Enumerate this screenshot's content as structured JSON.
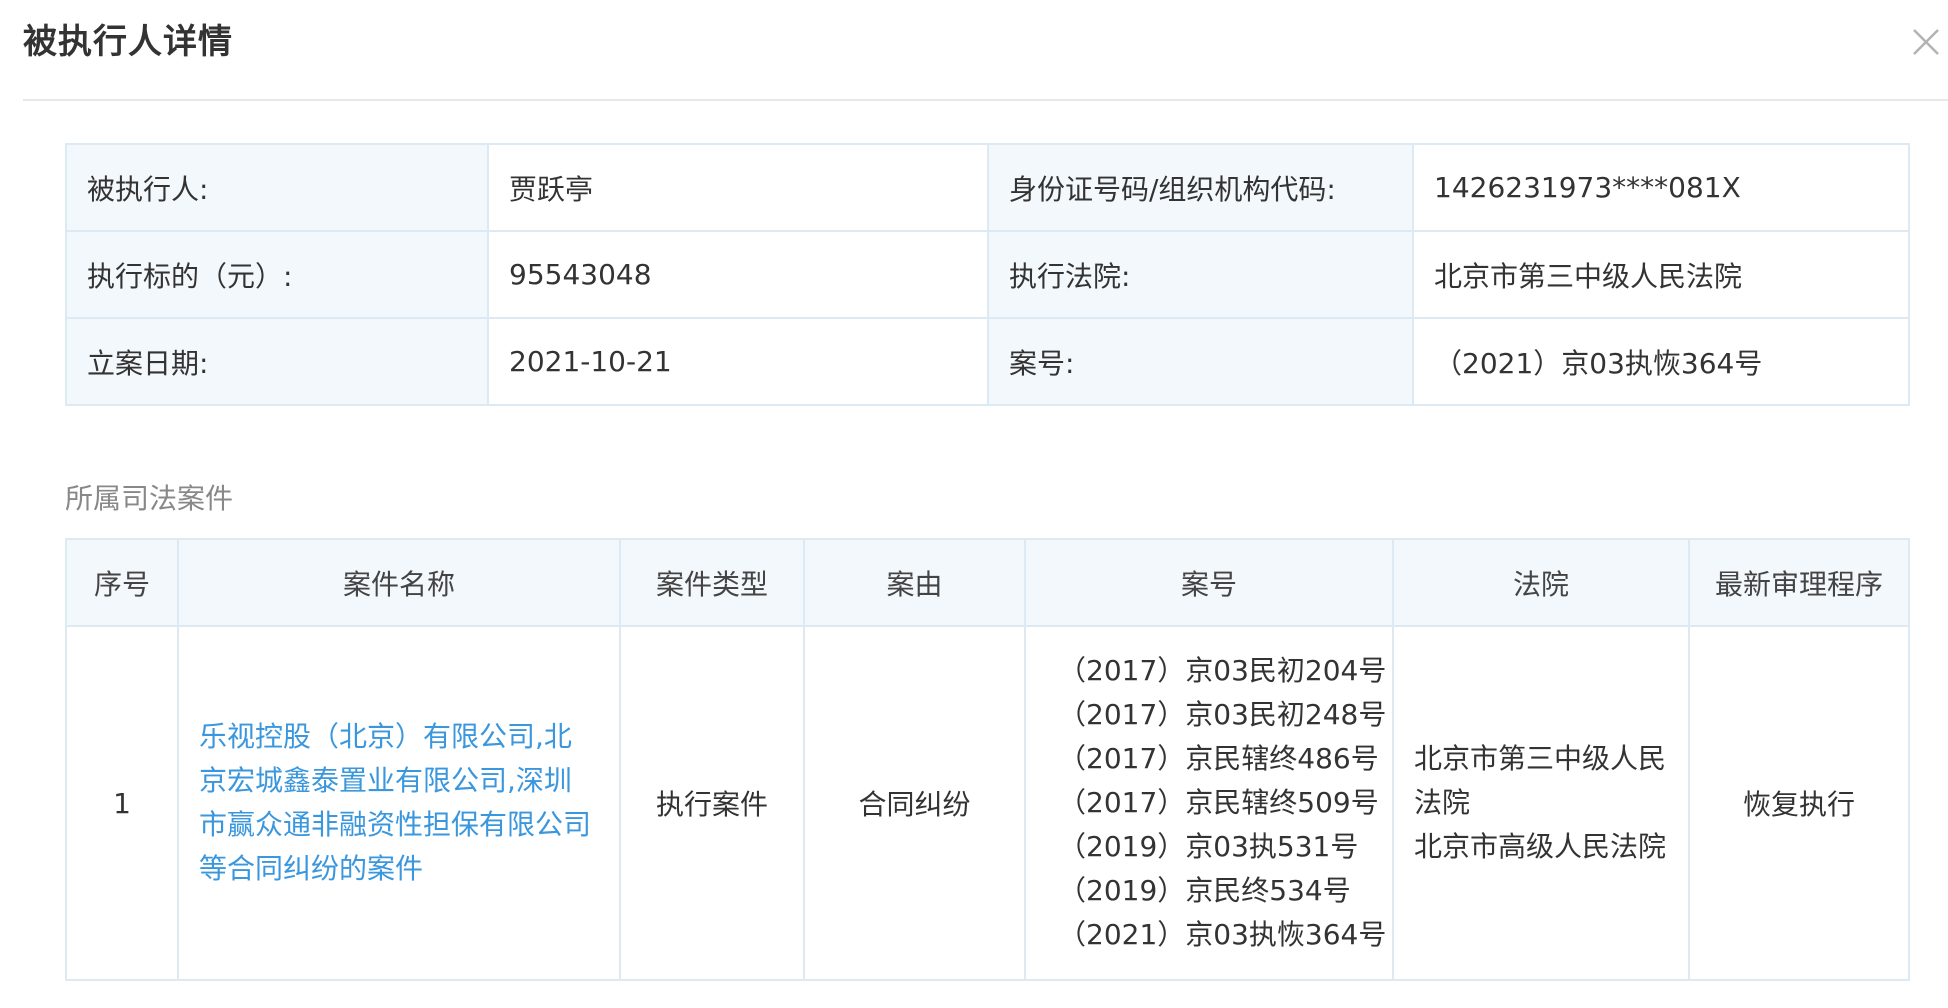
{
  "dialog": {
    "title": "被执行人详情"
  },
  "info": {
    "rows": [
      {
        "label1": "被执行人:",
        "value1": "贾跃亭",
        "label2": "身份证号码/组织机构代码:",
        "value2": "1426231973****081X"
      },
      {
        "label1": "执行标的（元）:",
        "value1": "95543048",
        "label2": "执行法院:",
        "value2": "北京市第三中级人民法院"
      },
      {
        "label1": "立案日期:",
        "value1": "2021-10-21",
        "label2": "案号:",
        "value2": "（2021）京03执恢364号"
      }
    ]
  },
  "cases": {
    "section_title": "所属司法案件",
    "headers": [
      "序号",
      "案件名称",
      "案件类型",
      "案由",
      "案号",
      "法院",
      "最新审理程序"
    ],
    "rows": [
      {
        "index": "1",
        "name": "乐视控股（北京）有限公司,北京宏城鑫泰置业有限公司,深圳市赢众通非融资性担保有限公司等合同纠纷的案件",
        "type": "执行案件",
        "cause": "合同纠纷",
        "case_numbers": [
          "（2017）京03民初204号",
          "（2017）京03民初248号",
          "（2017）京民辖终486号",
          "（2017）京民辖终509号",
          "（2019）京03执531号",
          "（2019）京民终534号",
          "（2021）京03执恢364号"
        ],
        "courts": [
          "北京市第三中级人民法院",
          "北京市高级人民法院"
        ],
        "procedure": "恢复执行"
      }
    ]
  },
  "colors": {
    "link": "#3a97dd",
    "label_bg": "#f3f8fc",
    "border": "#ddeaf3"
  }
}
